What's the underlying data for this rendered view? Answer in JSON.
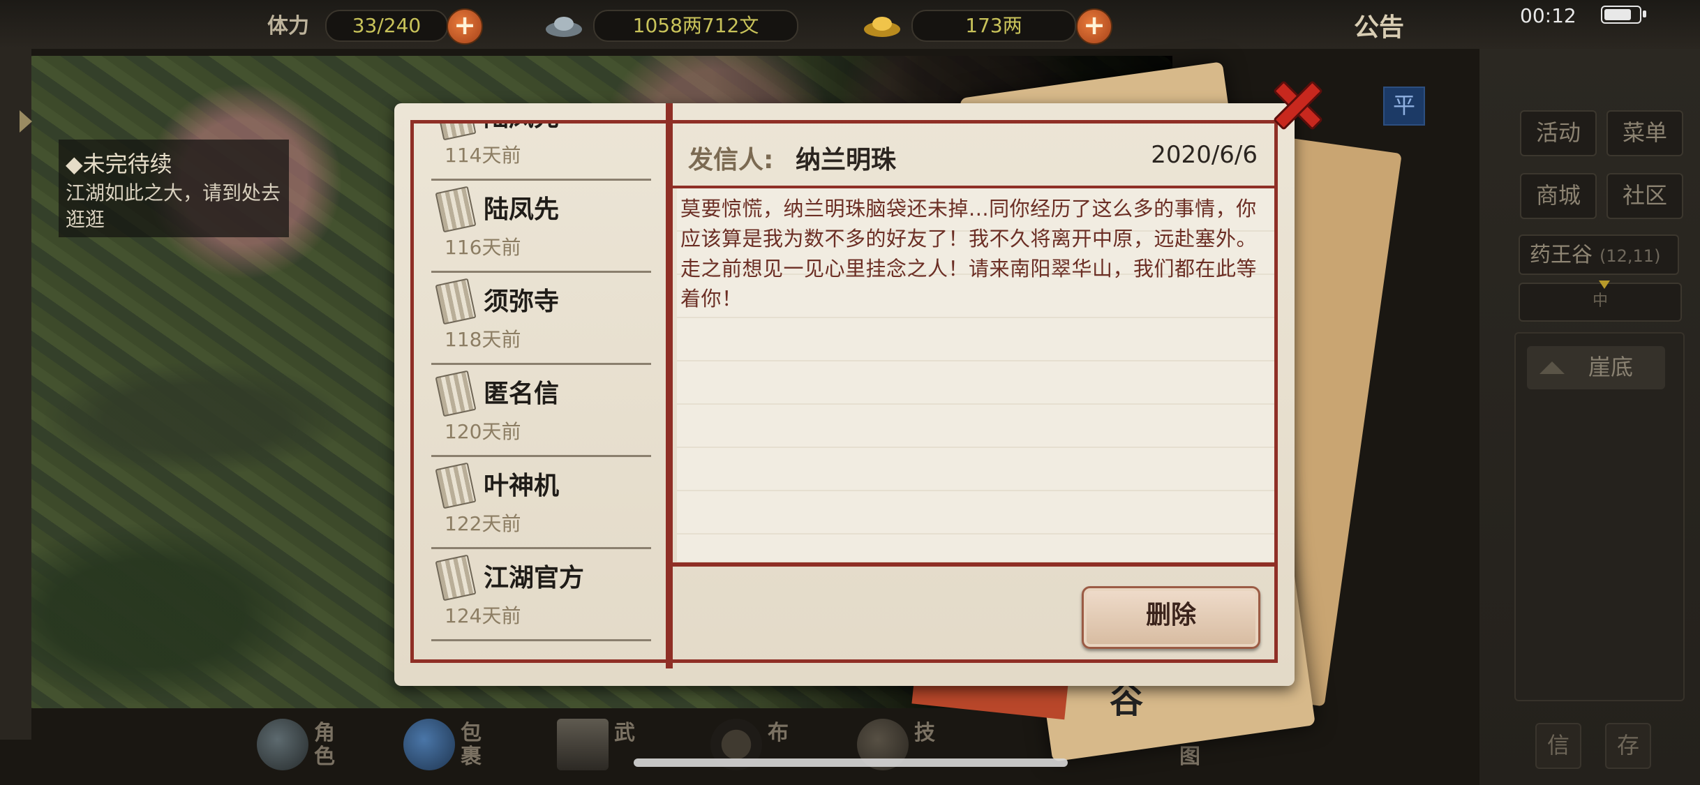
{
  "top_bar": {
    "stamina_label": "体力",
    "stamina_value": "33/240",
    "silver_value": "1058两712文",
    "gold_value": "173两",
    "notice_label": "公告",
    "time": "00:12"
  },
  "quest": {
    "title": "◆未完待续",
    "description": "江湖如此之大，请到处去逛逛"
  },
  "right_panel": {
    "buttons": [
      "活动",
      "菜单",
      "商城",
      "社区"
    ],
    "location_name": "药王谷",
    "location_coord": "(12,11)",
    "compass_text": "中",
    "region_label": "崖底",
    "ping_label": "平"
  },
  "mail_list": [
    {
      "sender": "陆凤先",
      "time": "114天前"
    },
    {
      "sender": "陆凤先",
      "time": "116天前"
    },
    {
      "sender": "须弥寺",
      "time": "118天前"
    },
    {
      "sender": "匿名信",
      "time": "120天前"
    },
    {
      "sender": "叶神机",
      "time": "122天前"
    },
    {
      "sender": "江湖官方",
      "time": "124天前"
    }
  ],
  "mail_detail": {
    "sender_label": "发信人:",
    "sender_name": "纳兰明珠",
    "date": "2020/6/6",
    "body": "莫要惊慌，纳兰明珠脑袋还未掉...同你经历了这么多的事情，你应该算是我为数不多的好友了！我不久将离开中原，远赴塞外。走之前想见一见心里挂念之人！请来南阳翠华山，我们都在此等着你！",
    "delete_label": "删除"
  },
  "bottom_nav": [
    {
      "label": "角色",
      "icon": "character-icon"
    },
    {
      "label": "包裹",
      "icon": "bag-icon"
    },
    {
      "label": "武",
      "icon": "martial-arts-icon"
    },
    {
      "label": "布",
      "icon": "formation-icon"
    },
    {
      "label": "技",
      "icon": "skill-icon"
    },
    {
      "label": "地图",
      "icon": "map-icon"
    }
  ],
  "bottom_right_buttons": [
    "信",
    "存"
  ],
  "background_paper_char": "谷",
  "colors": {
    "frame_red": "#8f2f26",
    "paper": "#ece5d6",
    "body_text": "#6b2e24",
    "accent_orange": "#e87a3a"
  }
}
